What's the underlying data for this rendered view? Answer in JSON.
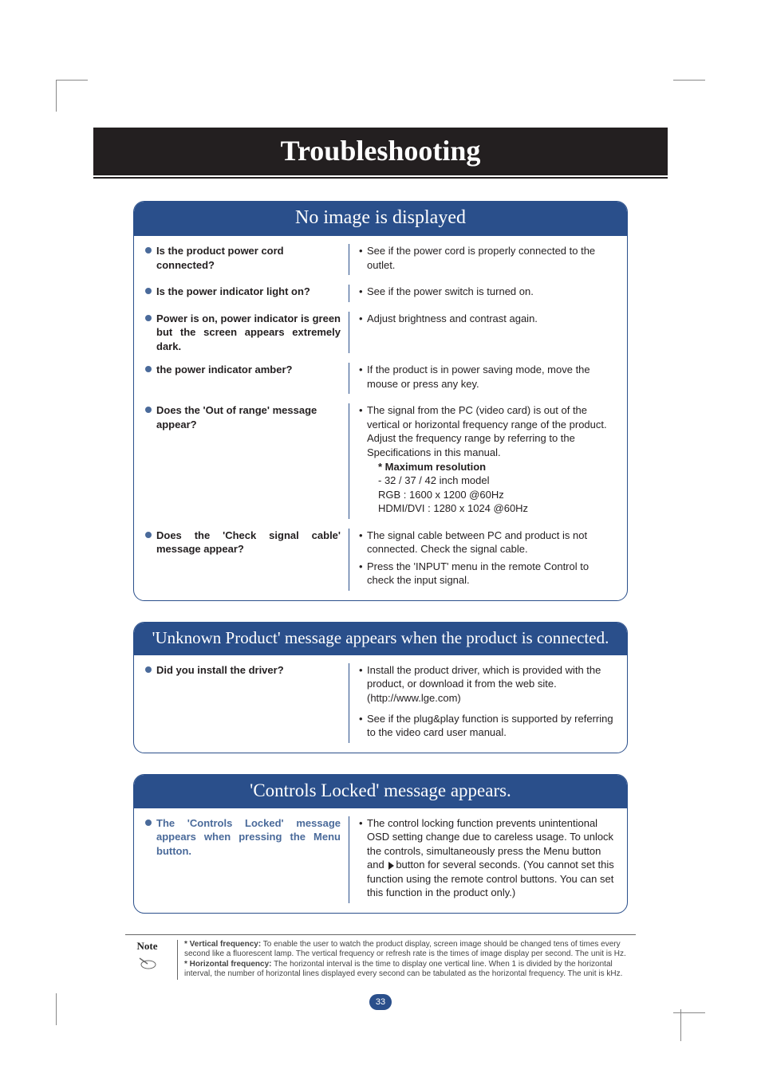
{
  "page": {
    "title": "Troubleshooting",
    "number": "33"
  },
  "box1": {
    "header": "No image is displayed",
    "rows": [
      {
        "q": "Is the product power cord connected?",
        "a": [
          "See if the power cord is properly connected to the outlet."
        ]
      },
      {
        "q": "Is the power indicator light on?",
        "a": [
          "See if the power switch is turned on."
        ]
      },
      {
        "q": "Power is on, power indicator is green but the screen appears extremely dark.",
        "a": [
          "Adjust brightness and contrast again."
        ]
      },
      {
        "q": "the power indicator amber?",
        "a": [
          "If the product is in power saving mode, move the mouse or press any key."
        ]
      },
      {
        "q": "Does the 'Out of range' message appear?",
        "a_complex": {
          "lead": "The signal from the PC (video card) is out of the vertical or horizontal frequency range of the product. Adjust the frequency range by referring to the Specifications in this manual.",
          "sub_bold": "* Maximum resolution",
          "sub_lines": [
            "- 32 / 37 / 42 inch model",
            "RGB : 1600 x 1200 @60Hz",
            "HDMI/DVI : 1280 x 1024 @60Hz"
          ]
        }
      },
      {
        "q": "Does the 'Check signal cable' message appear?",
        "a": [
          "The signal cable between PC and product is not connected. Check the signal cable.",
          "Press the 'INPUT' menu in the remote Control to check the input signal."
        ]
      }
    ]
  },
  "box2": {
    "header": "'Unknown Product' message appears when the product is connected.",
    "q": "Did you install the driver?",
    "a1": "Install the product driver, which is provided with the product, or download it from the web site. (http://www.lge.com)",
    "a2": "See if the plug&play function is supported by referring to the video card user manual."
  },
  "box3": {
    "header": "'Controls Locked' message appears.",
    "q": "The 'Controls Locked' message appears when pressing the Menu button.",
    "a_pre": "The control locking function prevents unintentional OSD setting change due to careless usage. To unlock the controls, simultaneously press the Menu button and ",
    "a_post": "button for several seconds. (You cannot set this function using the remote control buttons. You can set this function in the product only.)"
  },
  "note": {
    "label": "Note",
    "vf_label": "* Vertical frequency:",
    "vf_text": " To enable the user to watch the product display, screen image should be changed tens of times every second like a fluorescent lamp. The vertical frequency or refresh rate is the times of image display per second. The unit is Hz.",
    "hf_label": "* Horizontal frequency:",
    "hf_text": " The horizontal interval is the time to display one vertical line. When 1 is divided by the horizontal interval, the number of horizontal lines displayed every second can be tabulated as the horizontal frequency. The unit is kHz."
  }
}
